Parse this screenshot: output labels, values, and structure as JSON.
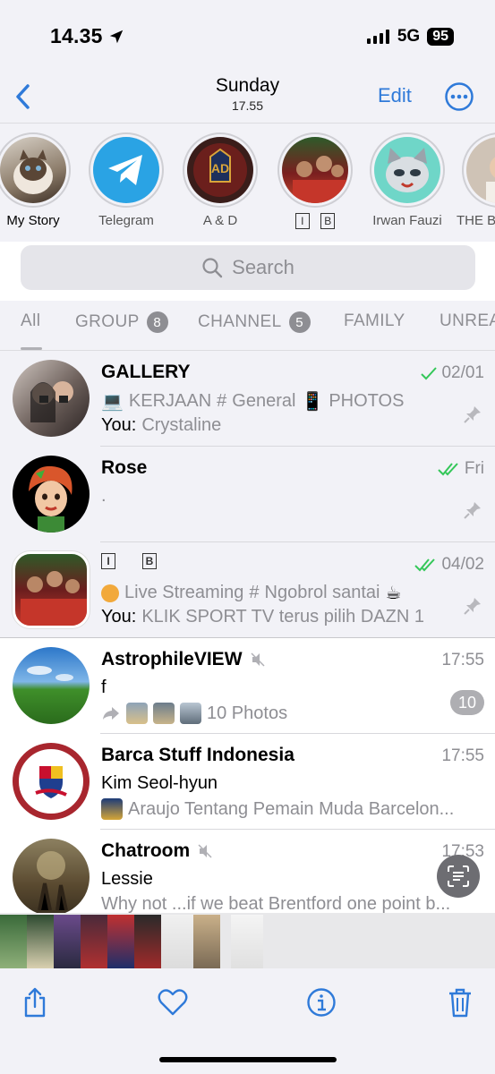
{
  "status_bar": {
    "time": "14.35",
    "network": "5G",
    "battery": "95"
  },
  "nav": {
    "back_icon": "chevron-left-icon",
    "title": "Sunday",
    "subtitle": "17.55",
    "edit_label": "Edit",
    "more_icon": "ellipsis-circle-icon"
  },
  "stories": [
    {
      "name": "My Story"
    },
    {
      "name": "Telegram"
    },
    {
      "name": "A & D"
    },
    {
      "name": "I B"
    },
    {
      "name": "Irwan Fauzi"
    },
    {
      "name": "THE B"
    }
  ],
  "search": {
    "placeholder": "Search"
  },
  "filters": [
    {
      "label": "All",
      "badge": ""
    },
    {
      "label": "GROUP",
      "badge": "8"
    },
    {
      "label": "CHANNEL",
      "badge": "5"
    },
    {
      "label": "FAMILY",
      "badge": ""
    },
    {
      "label": "UNREA",
      "badge": ""
    }
  ],
  "chats": [
    {
      "name": "GALLERY",
      "time": "02/01",
      "topics": [
        "KERJAAN",
        "General",
        "PHOTOS"
      ],
      "sender": "You:",
      "message": "Crystaline",
      "pinned": true,
      "read": "single"
    },
    {
      "name": "Rose",
      "time": "Fri",
      "line1": ".",
      "pinned": true,
      "read": "double"
    },
    {
      "name": "I B",
      "time": "04/02",
      "topics": [
        "Live Streaming",
        "Ngobrol santai"
      ],
      "sender": "You:",
      "message": "KLIK SPORT TV terus pilih DAZN 1",
      "pinned": true,
      "read": "double"
    },
    {
      "name": "AstrophileVIEW",
      "time": "17:55",
      "line1": "f",
      "line2": "10 Photos",
      "unread": "10",
      "muted": true
    },
    {
      "name": "Barca Stuff Indonesia",
      "time": "17:55",
      "line1": "Kim Seol-hyun",
      "line2": "Araujo Tentang Pemain Muda Barcelon..."
    },
    {
      "name": "Chatroom",
      "time": "17:53",
      "line1": "Lessie",
      "line2": "Why not ...if we beat Brentford one point b...",
      "muted": true
    }
  ],
  "toolbar": {
    "share_icon": "share-icon",
    "favorite_icon": "heart-icon",
    "info_icon": "info-icon",
    "delete_icon": "trash-icon"
  },
  "colors": {
    "accent": "#2f7ad9",
    "read_check": "#34c759",
    "background": "#f2f2f7"
  }
}
